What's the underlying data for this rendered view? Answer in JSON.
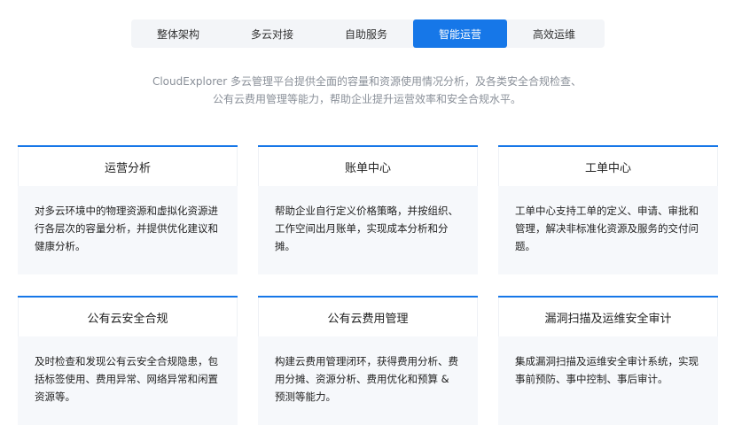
{
  "tabs": [
    {
      "label": "整体架构",
      "active": false
    },
    {
      "label": "多云对接",
      "active": false
    },
    {
      "label": "自助服务",
      "active": false
    },
    {
      "label": "智能运营",
      "active": true
    },
    {
      "label": "高效运维",
      "active": false
    }
  ],
  "intro": "CloudExplorer 多云管理平台提供全面的容量和资源使用情况分析，及各类安全合规检查、公有云费用管理等能力，帮助企业提升运营效率和安全合规水平。",
  "cards": [
    {
      "title": "运营分析",
      "desc": "对多云环境中的物理资源和虚拟化资源进行各层次的容量分析，并提供优化建议和健康分析。"
    },
    {
      "title": "账单中心",
      "desc": "帮助企业自行定义价格策略，并按组织、工作空间出月账单，实现成本分析和分摊。"
    },
    {
      "title": "工单中心",
      "desc": "工单中心支持工单的定义、申请、审批和管理，解决非标准化资源及服务的交付问题。"
    },
    {
      "title": "公有云安全合规",
      "desc": "及时检查和发现公有云安全合规隐患，包括标签使用、费用异常、网络异常和闲置资源等。"
    },
    {
      "title": "公有云费用管理",
      "desc": "构建云费用管理闭环，获得费用分析、费用分摊、资源分析、费用优化和预算 & 预测等能力。"
    },
    {
      "title": "漏洞扫描及运维安全审计",
      "desc": "集成漏洞扫描及运维安全审计系统，实现事前预防、事中控制、事后审计。"
    }
  ],
  "colors": {
    "accent": "#1677e8",
    "card_bg": "#f6f8fb",
    "muted_text": "#8a9099"
  }
}
